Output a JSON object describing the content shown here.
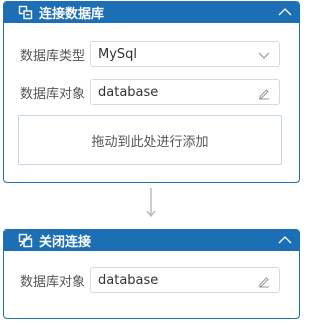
{
  "card1": {
    "title": "连接数据库",
    "db_type_label": "数据库类型",
    "db_type_value": "MySql",
    "db_object_label": "数据库对象",
    "db_object_value": "database",
    "dropzone_text": "拖动到此处进行添加"
  },
  "card2": {
    "title": "关闭连接",
    "db_object_label": "数据库对象",
    "db_object_value": "database"
  },
  "colors": {
    "header_bg": "#1c6fb5",
    "border": "#1c6fb5",
    "connector": "#b0b8c0"
  },
  "icons": {
    "card1_header": "database-connect-icon",
    "card2_header": "database-disconnect-icon",
    "collapse": "chevron-up-icon",
    "select": "chevron-down-icon",
    "edit": "pencil-icon"
  }
}
